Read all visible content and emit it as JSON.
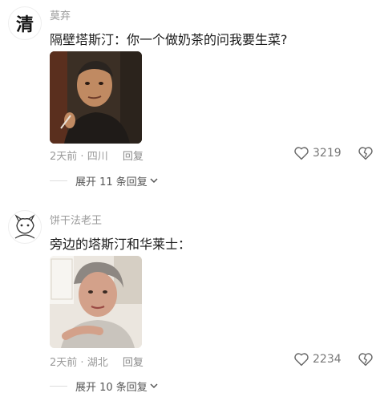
{
  "comments": [
    {
      "avatar_char": "清",
      "username": "莫弃",
      "text": "隔壁塔斯汀：你一个做奶茶的问我要生菜?",
      "time": "2天前",
      "location": "四川",
      "reply_label": "回复",
      "likes": "3219",
      "expand_label": "展开 11 条回复"
    },
    {
      "avatar_char": "",
      "username": "饼干法老王",
      "text": "旁边的塔斯汀和华莱士：",
      "time": "2天前",
      "location": "湖北",
      "reply_label": "回复",
      "likes": "2234",
      "expand_label": "展开 10 条回复"
    }
  ],
  "separator": " · ",
  "icons": {
    "like": "heart-outline-icon",
    "dislike": "broken-heart-icon",
    "expand": "chevron-down-icon"
  }
}
